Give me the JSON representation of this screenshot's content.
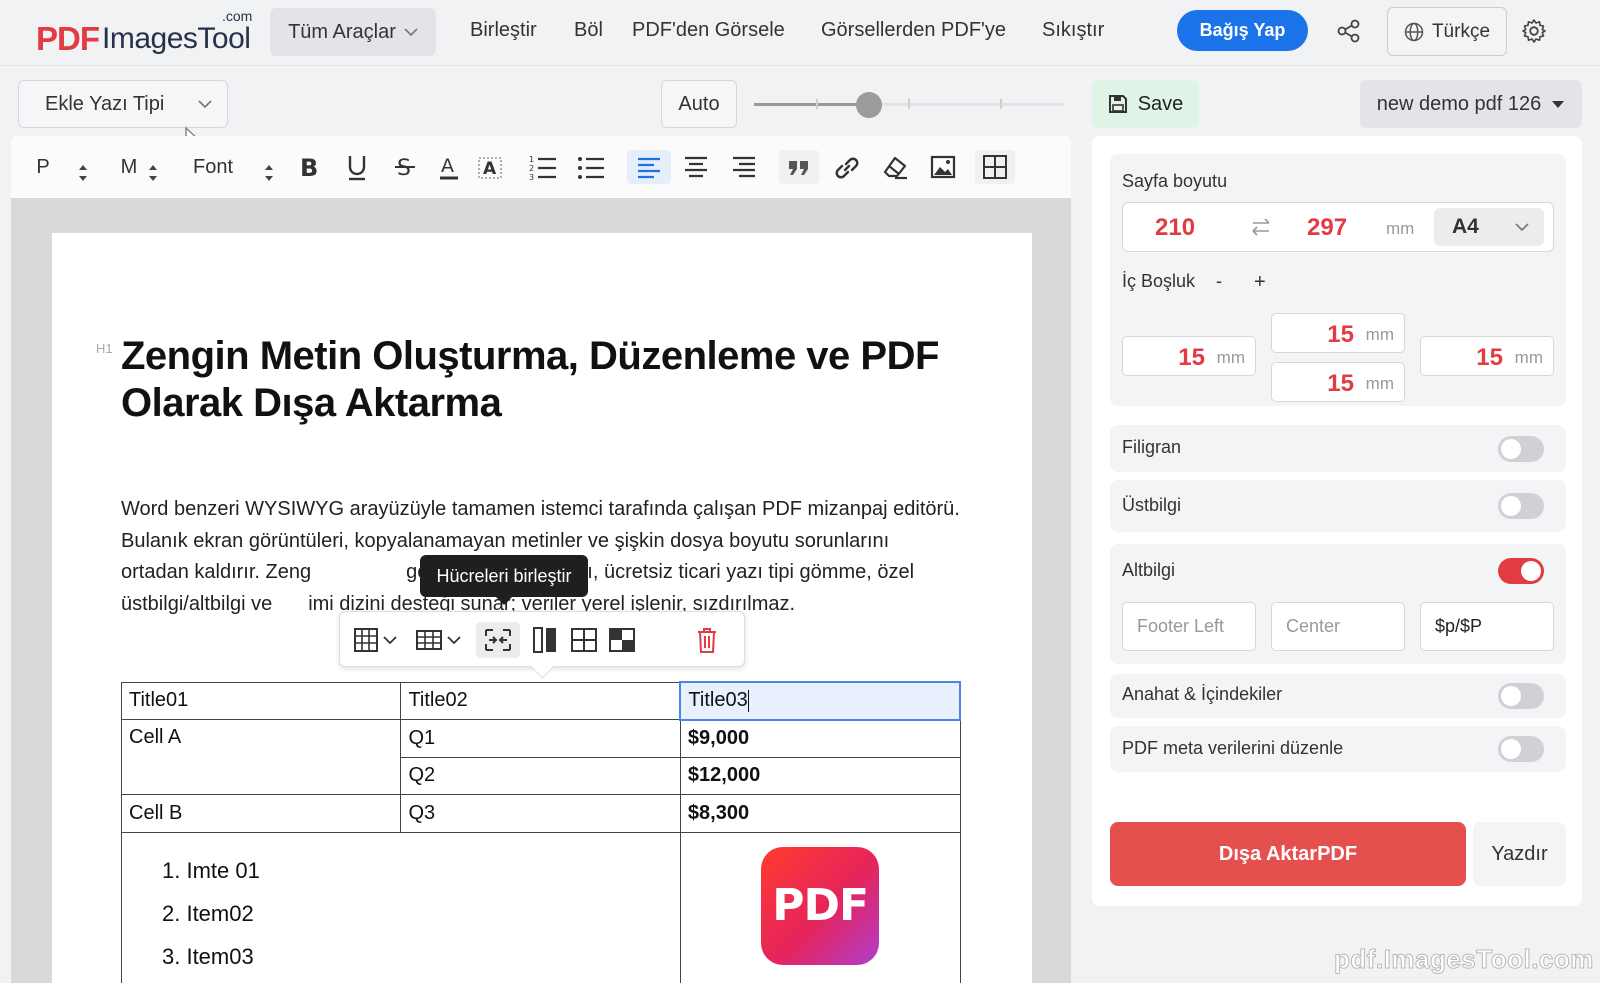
{
  "brand": {
    "pdf": "PDF",
    "name": "ImagesTool",
    "com": ".com"
  },
  "nav": {
    "tools": "Tüm Araçlar",
    "links": [
      "Birleştir",
      "Böl",
      "PDF'den Görsele",
      "Görsellerden PDF'ye",
      "Sıkıştır"
    ],
    "donate": "Bağış Yap",
    "language": "Türkçe"
  },
  "editor": {
    "font_select": "Ekle Yazı Tipi",
    "auto_label": "Auto",
    "zoom_level": 0.37,
    "toolbar": {
      "paragraph": "P",
      "size": "M",
      "font": "Font"
    }
  },
  "doc": {
    "h1_tag": "H1",
    "title": "Zengin Metin Oluşturma, Düzenleme ve PDF Olarak Dışa Aktarma",
    "para_a": "Word benzeri WYSIWYG arayüzüyle tamamen istemci tarafında çalışan PDF mizanpaj editörü. Bulanık ekran görüntüleri, kopyalanamayan metinler ve şişkin dosya boyutu sorunlarını ortadan kaldırır. Zeng",
    "para_b": "gelişmiş veri tabloları, ücretsiz ticari yazı tipi gömme, özel üstbilgi/altbilgi ve",
    "para_c": "imi dizini desteği sunar; veriler yerel işlenir, sızdırılmaz.",
    "tooltip": "Hücreleri birleştir",
    "table": {
      "headers": [
        "Title01",
        "Title02",
        "Title03"
      ],
      "cell_a": "Cell A",
      "q1": "Q1",
      "v1": "$9,000",
      "q2": "Q2",
      "v2": "$12,000",
      "cell_b": "Cell B",
      "q3": "Q3",
      "v3": "$8,300",
      "list": [
        "1. Imte 01",
        "2. Item02",
        "3. Item03"
      ],
      "logo_text": "PDF"
    }
  },
  "panel": {
    "save": "Save",
    "doc_name": "new demo pdf 126",
    "page_size_label": "Sayfa boyutu",
    "width": "210",
    "height": "297",
    "unit": "mm",
    "format": "A4",
    "padding_label": "İç Boşluk",
    "pad_minus": "-",
    "pad_plus": "+",
    "pad_top": "15",
    "pad_left": "15",
    "pad_bottom": "15",
    "pad_right": "15",
    "watermark": "Filigran",
    "header": "Üstbilgi",
    "footer": "Altbilgi",
    "footer_left_placeholder": "Footer Left",
    "footer_center_placeholder": "Center",
    "footer_right_value": "$p/$P",
    "outline": "Anahat & İçindekiler",
    "metadata": "PDF meta verilerini düzenle",
    "export": "Dışa AktarPDF",
    "print": "Yazdır"
  },
  "watermark_text": "pdf.ImagesTool.com",
  "colors": {
    "accent_red": "#e23b44",
    "accent_blue": "#1a73e8",
    "save_green": "#dff3e6"
  }
}
